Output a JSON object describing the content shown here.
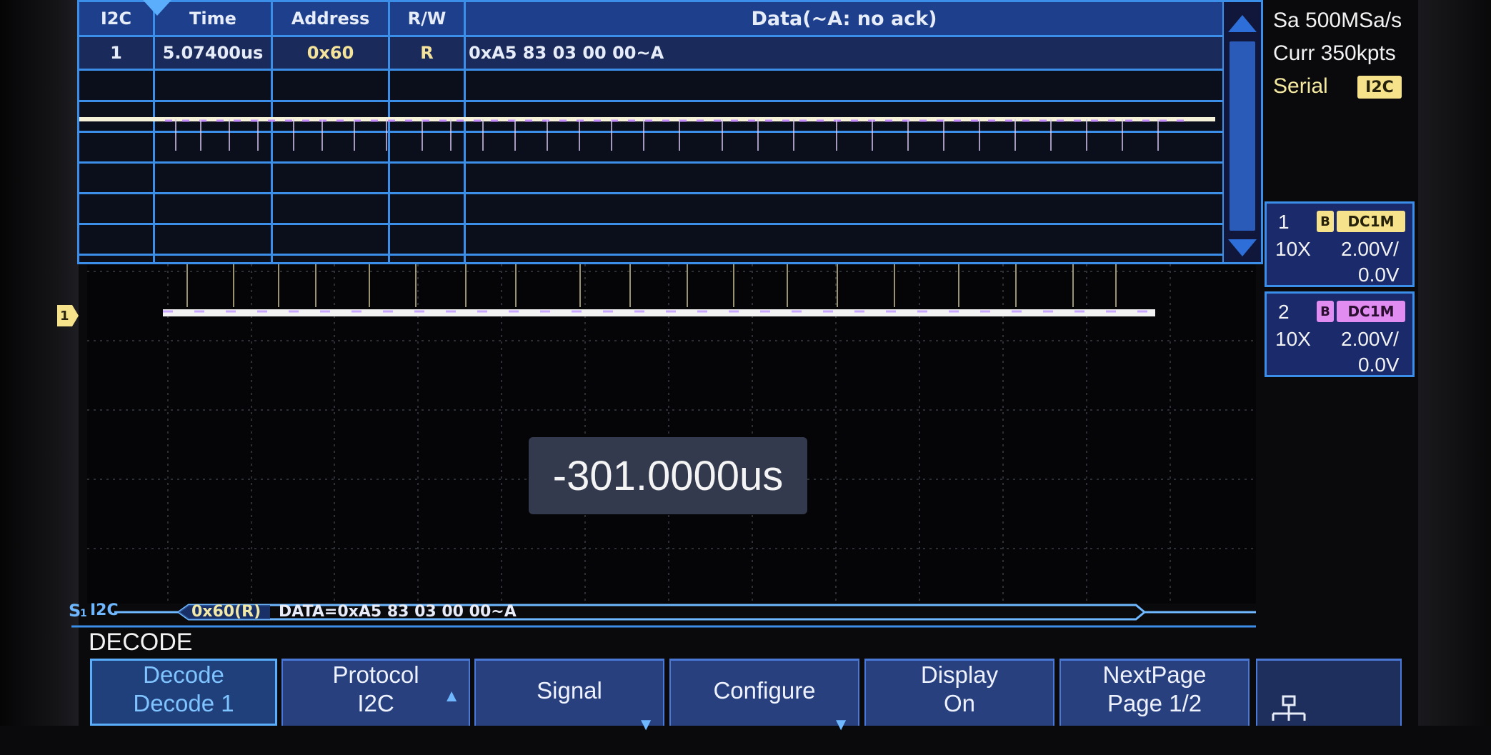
{
  "table": {
    "headers": [
      "I2C",
      "Time",
      "Address",
      "R/W",
      "Data(~A: no ack)"
    ],
    "rows": [
      {
        "index": "1",
        "time": "5.07400us",
        "address": "0x60",
        "rw": "R",
        "data": "0xA5 83 03 00 00~A"
      }
    ],
    "scroll_up_icon": "triangle-up-icon",
    "scroll_down_icon": "triangle-down-icon"
  },
  "right_panel": {
    "sample_rate": "Sa 500MSa/s",
    "memory_depth": "Curr 350kpts",
    "serial_label": "Serial",
    "serial_badge": "I2C",
    "channels": [
      {
        "number": "1",
        "bw": "B",
        "coupling": "DC1M",
        "probe": "10X",
        "scale": "2.00V/",
        "offset": "0.0V",
        "color": "#f7e28c"
      },
      {
        "number": "2",
        "bw": "B",
        "coupling": "DC1M",
        "probe": "10X",
        "scale": "2.00V/",
        "offset": "0.0V",
        "color": "#e08cf0"
      }
    ]
  },
  "channel_marker": "1",
  "time_readout": "-301.0000us",
  "bus": {
    "label": "S",
    "sub": "1",
    "protocol": "I2C",
    "frame_address": "0x60(R)",
    "frame_data": "DATA=0xA5 83 03 00 00~A"
  },
  "menu": {
    "title": "DECODE",
    "softkeys": [
      {
        "line1": "Decode",
        "line2": "Decode 1",
        "selected": true,
        "arrow": ""
      },
      {
        "line1": "Protocol",
        "line2": "I2C",
        "selected": false,
        "arrow": "up"
      },
      {
        "line1": "Signal",
        "line2": "",
        "selected": false,
        "arrow": "down"
      },
      {
        "line1": "Configure",
        "line2": "",
        "selected": false,
        "arrow": "down"
      },
      {
        "line1": "Display",
        "line2": "On",
        "selected": false,
        "arrow": ""
      },
      {
        "line1": "NextPage",
        "line2": "Page 1/2",
        "selected": false,
        "arrow": ""
      }
    ],
    "network_icon": "network-icon"
  }
}
